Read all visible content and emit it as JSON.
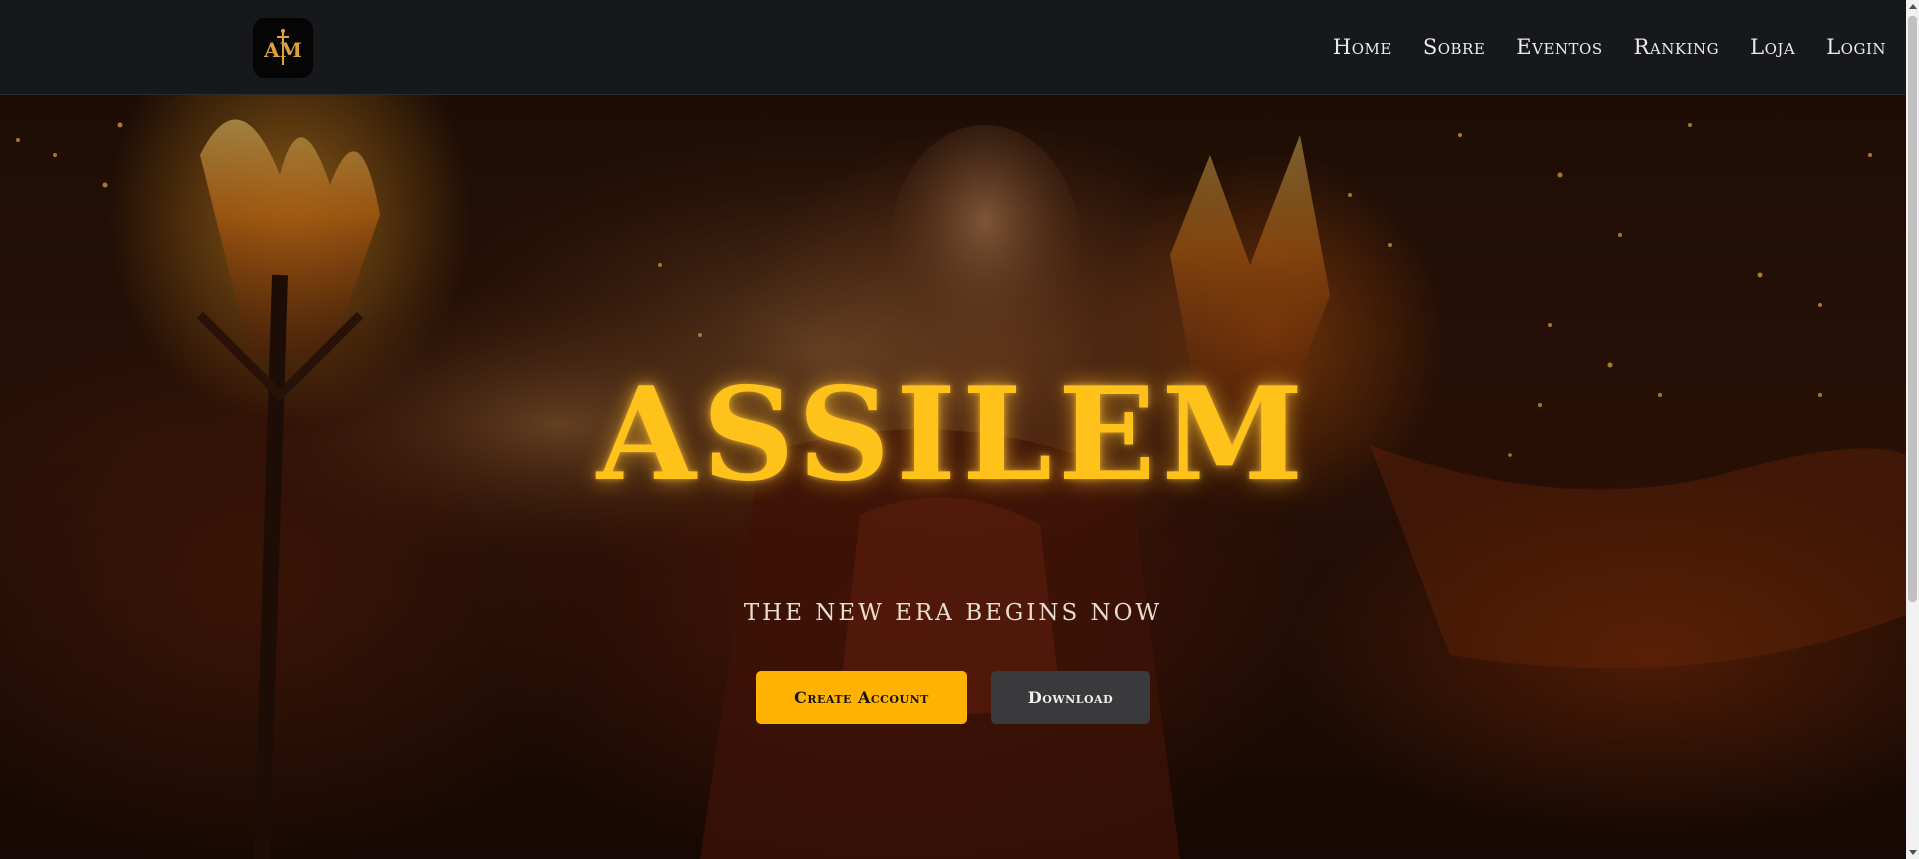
{
  "logo": {
    "text": "AM"
  },
  "nav": {
    "items": [
      {
        "label": "Home"
      },
      {
        "label": "Sobre"
      },
      {
        "label": "Eventos"
      },
      {
        "label": "Ranking"
      },
      {
        "label": "Loja"
      },
      {
        "label": "Login"
      }
    ]
  },
  "hero": {
    "title": "ASSILEM",
    "tagline": "THE NEW ERA BEGINS NOW",
    "primary_button": "Create Account",
    "secondary_button": "Download"
  },
  "colors": {
    "accent": "#ffb300",
    "title_gold": "#ffc21a",
    "navbar_bg": "#16181b",
    "secondary_button_bg": "#3a3a3c"
  }
}
